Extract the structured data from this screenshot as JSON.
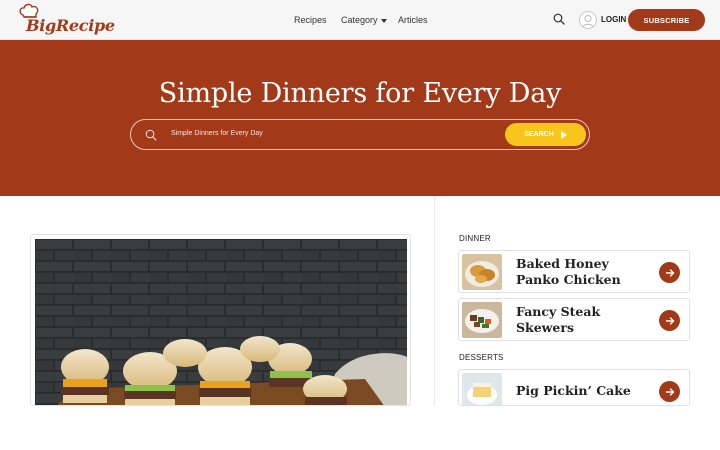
{
  "brand": {
    "name": "BigRecipe"
  },
  "nav": {
    "items": [
      {
        "label": "Recipes"
      },
      {
        "label": "Category"
      },
      {
        "label": "Articles"
      }
    ],
    "login_label": "LOGIN",
    "subscribe_label": "SUBSCRIBE"
  },
  "hero": {
    "title": "Simple Dinners for Every Day",
    "search_value": "Simple Dinners for Every Day",
    "search_button": "SEARCH"
  },
  "sidebar": {
    "sections": [
      {
        "label": "DINNER",
        "recipes": [
          {
            "title": "Baked Honey Panko Chicken"
          },
          {
            "title": "Fancy Steak Skewers"
          }
        ]
      },
      {
        "label": "DESSERTS",
        "recipes": [
          {
            "title": "Pig Pickin’ Cake"
          }
        ]
      }
    ]
  },
  "colors": {
    "brand": "#a23a1a",
    "accent": "#f7c51c",
    "header_bg": "#f6f6f6"
  },
  "icons": [
    "chef-hat-icon",
    "search-icon",
    "user-icon",
    "caret-down-icon",
    "arrow-right-icon",
    "play-icon"
  ]
}
